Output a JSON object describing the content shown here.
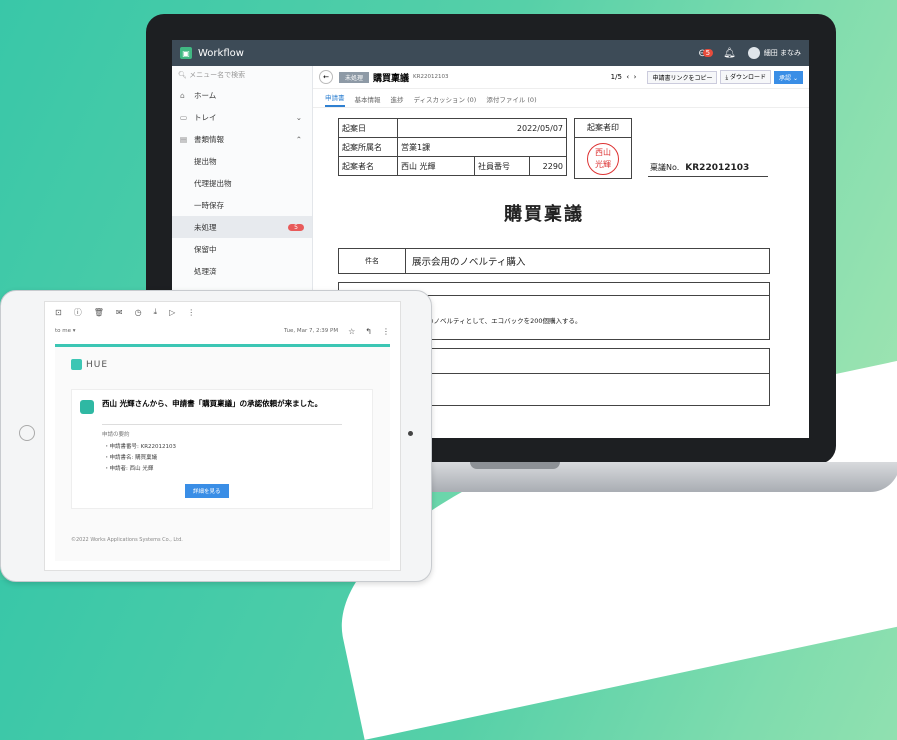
{
  "app": {
    "name": "Workflow",
    "user": "細田 まなみ",
    "bell_count": "5"
  },
  "sidebar": {
    "search_placeholder": "メニュー名で検索",
    "items": [
      {
        "label": "ホーム"
      },
      {
        "label": "トレイ"
      },
      {
        "label": "書類情報"
      },
      {
        "label": "提出物"
      },
      {
        "label": "代理提出物"
      },
      {
        "label": "一時保存"
      },
      {
        "label": "未処理",
        "count": "5"
      },
      {
        "label": "保留中"
      },
      {
        "label": "処理済"
      }
    ]
  },
  "doc_header": {
    "status": "未処理",
    "title": "購買稟議",
    "number": "KR22012103",
    "page": "1/5",
    "link_button": "申請書リンクをコピー",
    "download_button": "ダウンロード",
    "approve_button": "承認"
  },
  "tabs": [
    "申請書",
    "基本情報",
    "進捗",
    "ディスカッション (0)",
    "添付ファイル (0)"
  ],
  "form": {
    "rows": [
      {
        "label": "起案日",
        "value": "2022/05/07"
      },
      {
        "label": "起案所属名",
        "value": "営業1課"
      },
      {
        "label": "起案者名",
        "value": "西山 光輝",
        "label2": "社員番号",
        "value2": "2290"
      }
    ],
    "stamp_label": "起案者印",
    "stamp": [
      "西山",
      "光輝"
    ],
    "ringi_label": "稟議No.",
    "ringi_no": "KR22012103",
    "title": "購買稟議",
    "subject_label": "件名",
    "subject": "展示会用のノベルティ購入",
    "body_text": "のノベルティとして、エコバックを200個購入する。"
  },
  "email": {
    "to": "to me",
    "timestamp": "Tue, Mar 7, 2:39 PM",
    "brand": "HUE",
    "headline": "西山 光輝さんから、申請書「購買稟議」の承認依頼が来ました。",
    "summary_label": "申請の要約",
    "lines": [
      "・申請書番号: KR22012103",
      "・申請書名: 購買稟議",
      "・申請者: 西山 光輝"
    ],
    "detail_button": "詳細を見る",
    "footer": "©2022 Works Applications Systems Co., Ltd."
  }
}
